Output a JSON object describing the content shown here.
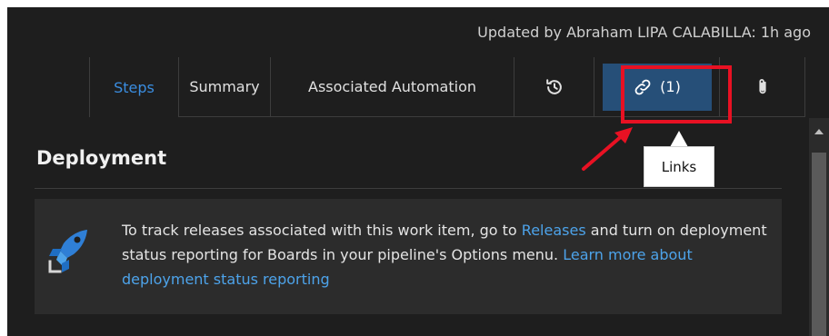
{
  "header": {
    "updated_text": "Updated by Abraham LIPA CALABILLA: 1h ago"
  },
  "tabs": [
    {
      "label": "Steps",
      "active": true
    },
    {
      "label": "Summary",
      "active": false
    },
    {
      "label": "Associated Automation",
      "active": false
    },
    {
      "icon": "history-icon",
      "label": ""
    },
    {
      "icon": "link-icon",
      "label": "(1)",
      "highlighted": true
    },
    {
      "icon": "paperclip-icon",
      "label": ""
    }
  ],
  "tooltip": {
    "text": "Links"
  },
  "section": {
    "title": "Deployment",
    "info_icon": "pipelines-icon",
    "text_part1": "To track releases associated with this work item, go to ",
    "link_releases": "Releases",
    "text_part2": " and turn on deployment status reporting for Boards in your pipeline's Options menu. ",
    "link_learn_more": "Learn more about deployment status reporting"
  },
  "colors": {
    "background": "#1e1e1e",
    "accent": "#3a8de0",
    "highlight": "#e81123",
    "selected_tab": "#264f78"
  }
}
